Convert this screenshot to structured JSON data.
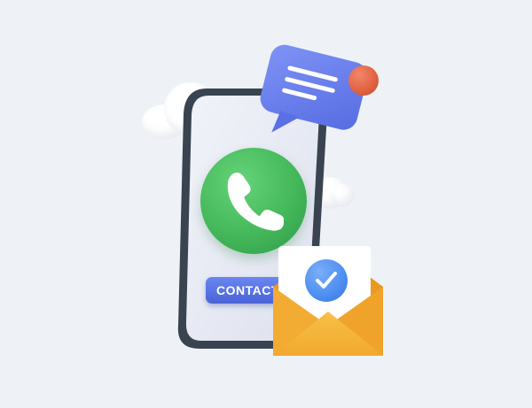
{
  "illustration": {
    "contact_button_label": "CONTACT",
    "colors": {
      "background": "#eef2f7",
      "phone_frame": "#3a4350",
      "phone_screen": "#e8ebf4",
      "call_icon": "#44b85a",
      "chat_bubble": "#6a80ef",
      "notification_dot": "#e0613f",
      "envelope": "#f6b63c",
      "check_badge": "#4d8ef0",
      "contact_button": "#5570e6"
    },
    "icons": [
      "cloud-icon",
      "smartphone-icon",
      "phone-handset-icon",
      "chat-bubble-icon",
      "notification-dot-icon",
      "envelope-icon",
      "checkmark-icon"
    ]
  }
}
